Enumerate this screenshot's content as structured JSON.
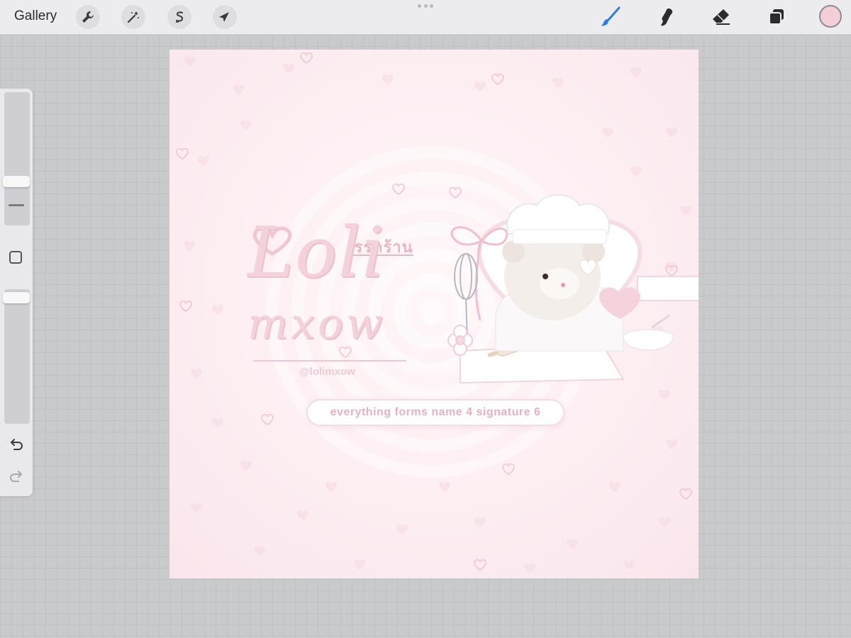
{
  "toolbar": {
    "gallery_label": "Gallery",
    "left_tools": [
      {
        "name": "actions",
        "icon": "wrench-icon"
      },
      {
        "name": "adjustments",
        "icon": "magic-wand-icon"
      },
      {
        "name": "selection",
        "icon": "selection-s-icon"
      },
      {
        "name": "transform",
        "icon": "arrow-cursor-icon"
      }
    ],
    "right_tools": [
      {
        "name": "brush",
        "icon": "brush-icon",
        "active": true
      },
      {
        "name": "smudge",
        "icon": "smudge-icon"
      },
      {
        "name": "eraser",
        "icon": "eraser-icon"
      },
      {
        "name": "layers",
        "icon": "layers-icon"
      }
    ],
    "current_color": "#f3cdd8",
    "accent_color": "#2f7be0"
  },
  "sidebar": {
    "brush_size_level": 0.17,
    "opacity_level": 0.07,
    "undo_icon": "undo-icon",
    "redo_icon": "redo-icon",
    "modify_icon": "square-icon"
  },
  "artwork": {
    "thai_title": "เรรดร้าน",
    "script_line1": "Loli",
    "script_line2": "mxow",
    "handle": "@lolimxow",
    "pill_text": "everything forms  name 4 signature 6",
    "palette": {
      "background": "#fdeef2",
      "accent_pink": "#e6b2c2"
    }
  }
}
